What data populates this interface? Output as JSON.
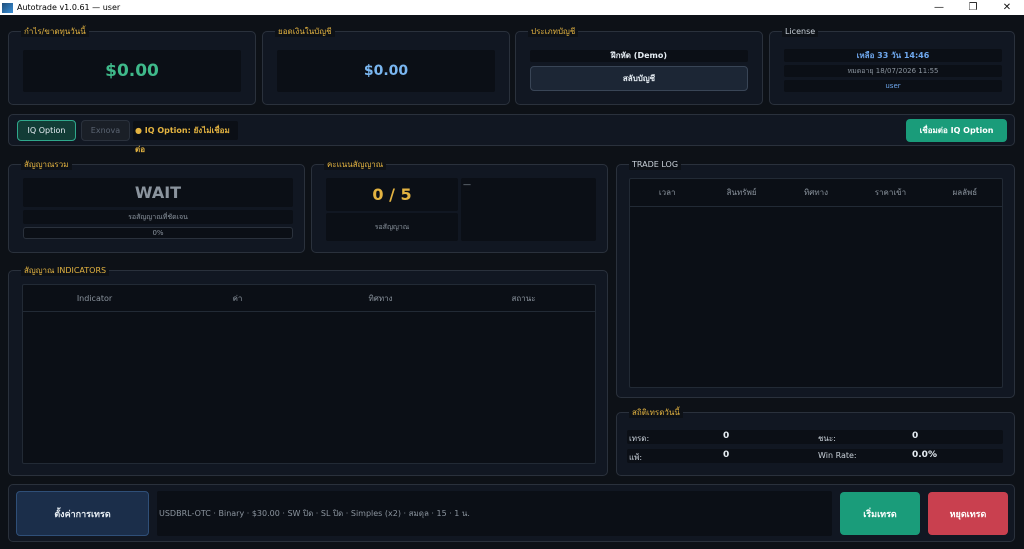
{
  "window": {
    "title": "Autotrade v1.0.61 — user",
    "minimize_glyph": "—",
    "restore_glyph": "❐",
    "close_glyph": "✕"
  },
  "top_cards": {
    "profit": {
      "title": "กำไร/ขาดทุนวันนี้",
      "value": "$0.00"
    },
    "balance": {
      "title": "ยอดเงินในบัญชี",
      "value": "$0.00"
    },
    "account": {
      "title": "ประเภทบัญชี",
      "type": "ฝึกหัด (Demo)",
      "switch_label": "สลับบัญชี"
    },
    "license": {
      "title": "License",
      "remaining": "เหลือ 33 วัน 14:46",
      "expiry": "หมดอายุ 18/07/2026 11:55",
      "user": "user"
    }
  },
  "broker_bar": {
    "iq_option_tab": "IQ Option",
    "exnova_tab": "Exnova",
    "status": "● IQ Option: ยังไม่เชื่อมต่อ",
    "connect_label": "เชื่อมต่อ IQ Option"
  },
  "signal_summary": {
    "title": "สัญญาณรวม",
    "value": "WAIT",
    "subtitle": "รอสัญญาณที่ชัดเจน",
    "progress_text": "0%",
    "progress": 0
  },
  "signal_score": {
    "title": "คะแนนสัญญาณ",
    "score": "0 / 5",
    "subtitle": "รอสัญญาณ",
    "detail": "—"
  },
  "indicators": {
    "title": "สัญญาณ INDICATORS",
    "columns": [
      "Indicator",
      "ค่า",
      "ทิศทาง",
      "สถานะ"
    ]
  },
  "trade_log": {
    "title": "TRADE LOG",
    "columns": [
      "เวลา",
      "สินทรัพย์",
      "ทิศทาง",
      "ราคาเข้า",
      "ผลลัพธ์"
    ]
  },
  "stats": {
    "title": "สถิติเทรดวันนี้",
    "trades_label": "เทรด:",
    "trades_value": "0",
    "wins_label": "ชนะ:",
    "wins_value": "0",
    "losses_label": "แพ้:",
    "losses_value": "0",
    "winrate_label": "Win Rate:",
    "winrate_value": "0.0%"
  },
  "bottom_bar": {
    "settings_label": "ตั้งค่าการเทรด",
    "summary": "USDBRL-OTC · Binary · $30.00 · SW ปิด · SL ปิด · Simples (x2) · สมดุล · 15 · 1 น.",
    "start_label": "เริ่มเทรด",
    "stop_label": "หยุดเทรด"
  },
  "colors": {
    "background": "#0d1117",
    "panel": "#111722",
    "accent_green": "#1a9c7a",
    "accent_red": "#c9404f",
    "title_gold": "#e3b341",
    "profit_green": "#3fb98a",
    "balance_blue": "#7ab6f0"
  }
}
